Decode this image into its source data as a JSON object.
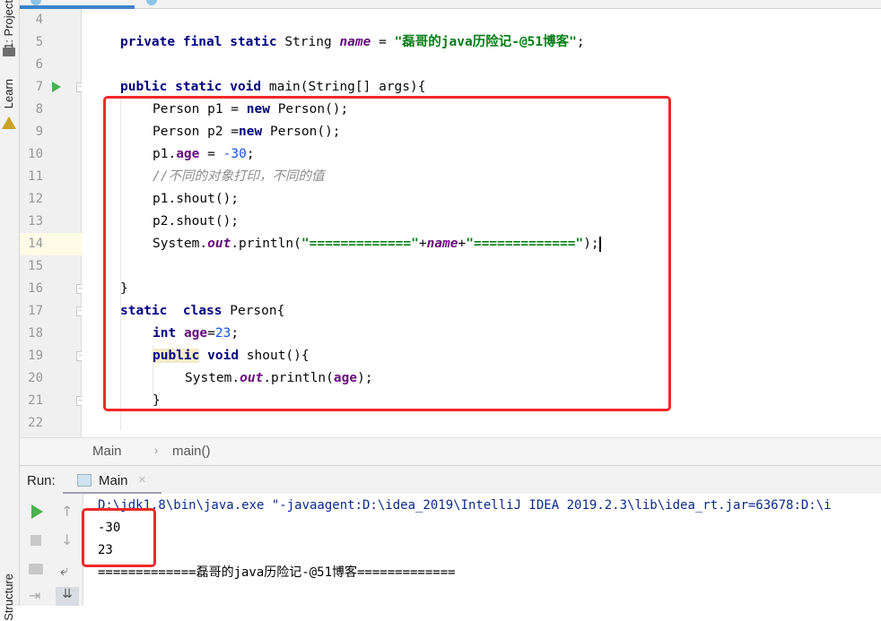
{
  "left_sidebar": {
    "project_label": "1: Project",
    "learn_label": "Learn",
    "structure_label": "Structure"
  },
  "editor": {
    "lines": [
      {
        "num": "4"
      },
      {
        "num": "5"
      },
      {
        "num": "6"
      },
      {
        "num": "7"
      },
      {
        "num": "8"
      },
      {
        "num": "9"
      },
      {
        "num": "10"
      },
      {
        "num": "11"
      },
      {
        "num": "12"
      },
      {
        "num": "13"
      },
      {
        "num": "14"
      },
      {
        "num": "15"
      },
      {
        "num": "16"
      },
      {
        "num": "17"
      },
      {
        "num": "18"
      },
      {
        "num": "19"
      },
      {
        "num": "20"
      },
      {
        "num": "21"
      },
      {
        "num": "22"
      }
    ],
    "code": {
      "l5_kw": "private final static",
      "l5_type": " String ",
      "l5_field": "name",
      "l5_eq": " = ",
      "l5_str": "\"磊哥的java历险记-@51博客\"",
      "l5_end": ";",
      "l7_kw": "public static void",
      "l7_rest": " main(String[] args){",
      "l8_a": "Person p1 = ",
      "l8_kw": "new",
      "l8_b": " Person();",
      "l9_a": "Person p2 =",
      "l9_kw": "new",
      "l9_b": " Person();",
      "l10_a": "p1.",
      "l10_field": "age",
      "l10_b": " = ",
      "l10_num": "-30",
      "l10_c": ";",
      "l11_comment": "//不同的对象打印，不同的值",
      "l12": "p1.shout();",
      "l13": "p2.shout();",
      "l14_a": "System.",
      "l14_out": "out",
      "l14_b": ".println(",
      "l14_str1": "\"=============\"",
      "l14_plus1": "+",
      "l14_name": "name",
      "l14_plus2": "+",
      "l14_str2": "\"=============\"",
      "l14_end": ");",
      "l16": "}",
      "l17_kw1": "static",
      "l17_kw2": "class",
      "l17_rest": " Person{",
      "l18_kw": "int",
      "l18_field": "age",
      "l18_eq": "=",
      "l18_num": "23",
      "l18_end": ";",
      "l19_kw1": "public",
      "l19_kw2": "void",
      "l19_rest": " shout(){",
      "l20_a": "System.",
      "l20_out": "out",
      "l20_b": ".println(",
      "l20_field": "age",
      "l20_c": ");",
      "l21": "}"
    }
  },
  "breadcrumb": {
    "items": [
      "Main",
      "main()"
    ],
    "separator": "›"
  },
  "run_panel": {
    "label": "Run:",
    "tab_label": "Main",
    "close_glyph": "×",
    "console_lines": [
      "D:\\jdk1.8\\bin\\java.exe \"-javaagent:D:\\idea_2019\\IntelliJ IDEA 2019.2.3\\lib\\idea_rt.jar=63678:D:\\i",
      "-30",
      "23",
      "=============磊哥的java历险记-@51博客============="
    ]
  },
  "colors": {
    "highlight_box": "#f0282a",
    "run_green": "#4caf50",
    "accent_blue": "#4083c9"
  }
}
